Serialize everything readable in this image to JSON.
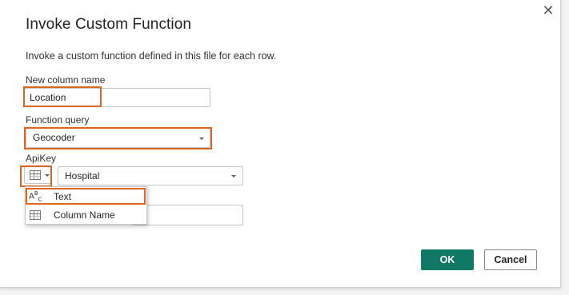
{
  "dialog": {
    "title": "Invoke Custom Function",
    "close_glyph": "✕",
    "description": "Invoke a custom function defined in this file for each row."
  },
  "new_column": {
    "label": "New column name",
    "value": "Location"
  },
  "function_query": {
    "label": "Function query",
    "selected": "Geocoder"
  },
  "apikey": {
    "label": "ApiKey",
    "type_icon": "table-icon",
    "column_selected": "Hospital"
  },
  "type_menu": {
    "items": [
      {
        "label": "Text",
        "icon": "abc-text-icon"
      },
      {
        "label": "Column Name",
        "icon": "table-icon"
      }
    ]
  },
  "buttons": {
    "ok": "OK",
    "cancel": "Cancel"
  },
  "colors": {
    "highlight": "#e0661e",
    "primary": "#117865"
  }
}
